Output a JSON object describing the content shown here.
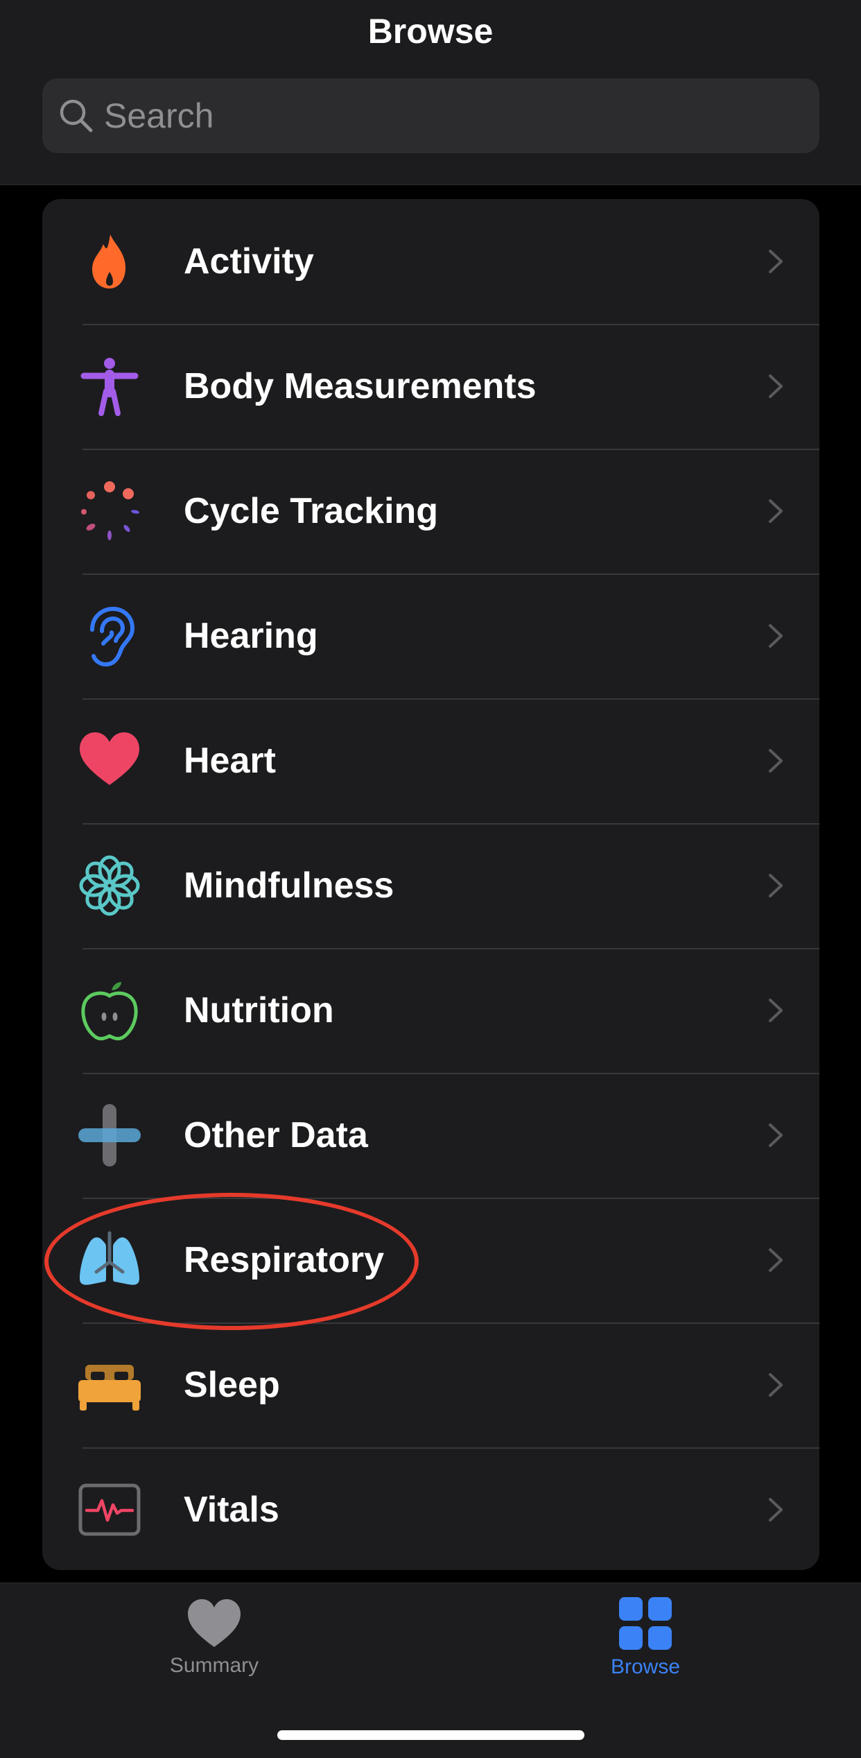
{
  "header": {
    "title": "Browse"
  },
  "search": {
    "placeholder": "Search",
    "value": ""
  },
  "categories": [
    {
      "label": "Activity",
      "icon": "flame-icon",
      "color": "#ff6a2b"
    },
    {
      "label": "Body Measurements",
      "icon": "figure-icon",
      "color": "#a35ce8"
    },
    {
      "label": "Cycle Tracking",
      "icon": "cycle-dots-icon",
      "color": "#e8615c"
    },
    {
      "label": "Hearing",
      "icon": "ear-icon",
      "color": "#3478f6"
    },
    {
      "label": "Heart",
      "icon": "heart-icon",
      "color": "#ef4565"
    },
    {
      "label": "Mindfulness",
      "icon": "flower-icon",
      "color": "#5ac8c8"
    },
    {
      "label": "Nutrition",
      "icon": "apple-icon",
      "color": "#5ccb5f"
    },
    {
      "label": "Other Data",
      "icon": "plus-icon",
      "color": "#5aa8d8"
    },
    {
      "label": "Respiratory",
      "icon": "lungs-icon",
      "color": "#6cc4f2"
    },
    {
      "label": "Sleep",
      "icon": "bed-icon",
      "color": "#f0a33a"
    },
    {
      "label": "Vitals",
      "icon": "vitals-icon",
      "color": "#ef4565"
    }
  ],
  "tabbar": {
    "tabs": [
      {
        "label": "Summary",
        "icon": "heart-icon",
        "selected": false
      },
      {
        "label": "Browse",
        "icon": "grid-icon",
        "selected": true
      }
    ]
  },
  "colors": {
    "accent": "#3b82f6",
    "annotation": "#e53a2b"
  }
}
